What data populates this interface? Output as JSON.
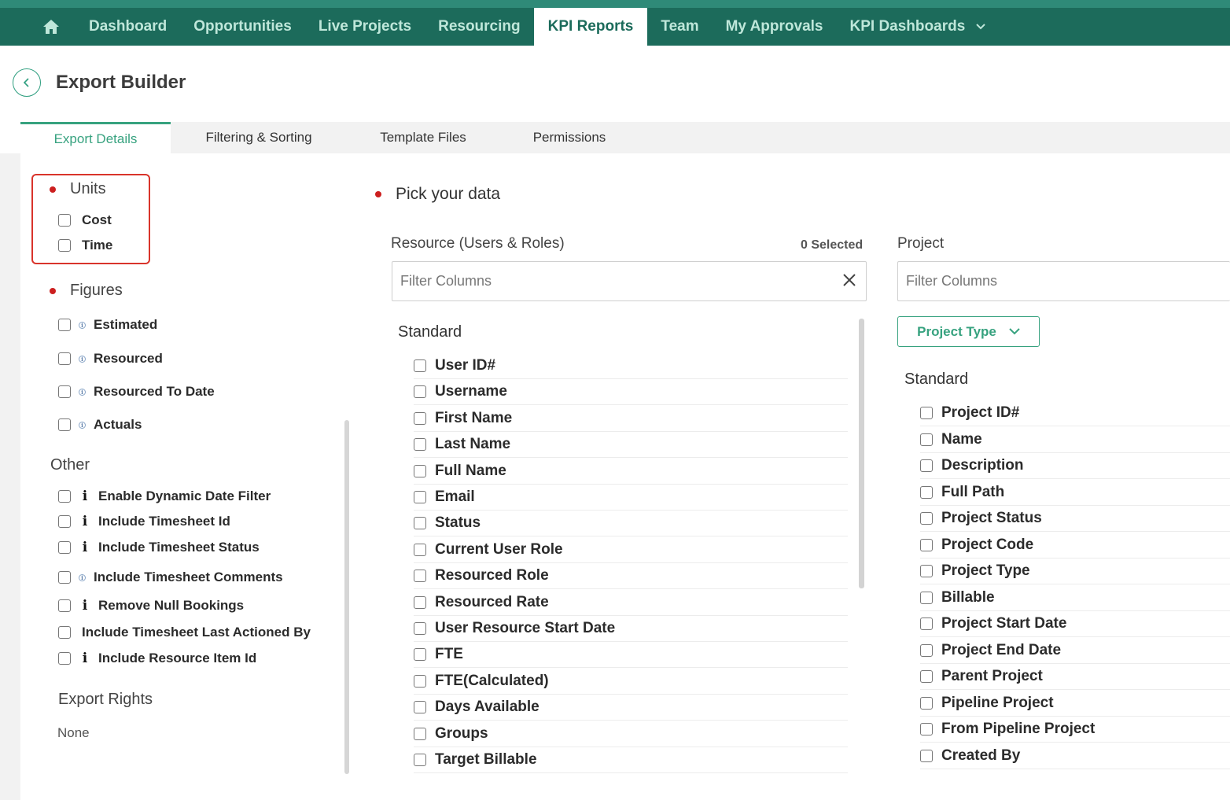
{
  "nav": {
    "items": [
      {
        "label": "Dashboard"
      },
      {
        "label": "Opportunities"
      },
      {
        "label": "Live Projects"
      },
      {
        "label": "Resourcing"
      },
      {
        "label": "KPI Reports"
      },
      {
        "label": "Team"
      },
      {
        "label": "My Approvals"
      },
      {
        "label": "KPI Dashboards"
      }
    ],
    "active": "KPI Reports"
  },
  "header": {
    "title": "Export Builder"
  },
  "tabs": [
    {
      "label": "Export Details"
    },
    {
      "label": "Filtering & Sorting"
    },
    {
      "label": "Template Files"
    },
    {
      "label": "Permissions"
    }
  ],
  "units": {
    "title": "Units",
    "options": [
      {
        "label": "Cost"
      },
      {
        "label": "Time"
      }
    ]
  },
  "figures": {
    "title": "Figures",
    "options": [
      {
        "label": "Estimated"
      },
      {
        "label": "Resourced"
      },
      {
        "label": "Resourced To Date"
      },
      {
        "label": "Actuals"
      }
    ]
  },
  "other": {
    "title": "Other",
    "options": [
      {
        "label": "Enable Dynamic Date Filter"
      },
      {
        "label": "Include Timesheet Id"
      },
      {
        "label": "Include Timesheet Status"
      },
      {
        "label": "Include Timesheet Comments"
      },
      {
        "label": "Remove Null Bookings"
      },
      {
        "label": "Include Timesheet Last Actioned By"
      },
      {
        "label": "Include Resource Item Id"
      }
    ]
  },
  "export_rights": {
    "title": "Export Rights",
    "value": "None"
  },
  "pick": {
    "title": "Pick your data",
    "resource": {
      "label": "Resource (Users & Roles)",
      "selected": "0 Selected",
      "filter_placeholder": "Filter Columns",
      "group": "Standard",
      "items": [
        "User ID#",
        "Username",
        "First Name",
        "Last Name",
        "Full Name",
        "Email",
        "Status",
        "Current User Role",
        "Resourced Role",
        "Resourced Rate",
        "User Resource Start Date",
        "FTE",
        "FTE(Calculated)",
        "Days Available",
        "Groups",
        "Target Billable"
      ]
    },
    "project": {
      "label": "Project",
      "filter_placeholder": "Filter Columns",
      "type_button": "Project Type",
      "group": "Standard",
      "items": [
        "Project ID#",
        "Name",
        "Description",
        "Full Path",
        "Project Status",
        "Project Code",
        "Project Type",
        "Billable",
        "Project Start Date",
        "Project End Date",
        "Parent Project",
        "Pipeline Project",
        "From Pipeline Project",
        "Created By"
      ]
    }
  },
  "colors": {
    "nav_bg": "#1c6b5b",
    "nav_text": "#bfe7da",
    "accent": "#37a27f",
    "required_dot": "#cc1f1f",
    "highlight_border": "#d9342b"
  }
}
